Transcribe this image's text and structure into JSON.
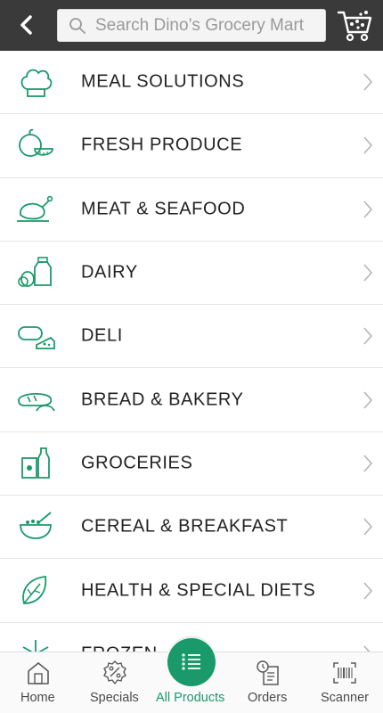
{
  "header": {
    "search_placeholder": "Search Dino’s Grocery Mart",
    "back_icon": "back-arrow-icon",
    "cart_icon": "cart-icon"
  },
  "categories": [
    {
      "label": "MEAL SOLUTIONS",
      "icon": "chef-hat-icon"
    },
    {
      "label": "FRESH PRODUCE",
      "icon": "produce-icon"
    },
    {
      "label": "MEAT & SEAFOOD",
      "icon": "chicken-icon"
    },
    {
      "label": "DAIRY",
      "icon": "milk-icon"
    },
    {
      "label": "DELI",
      "icon": "deli-icon"
    },
    {
      "label": "BREAD & BAKERY",
      "icon": "bread-icon"
    },
    {
      "label": "GROCERIES",
      "icon": "groceries-icon"
    },
    {
      "label": "CEREAL & BREAKFAST",
      "icon": "cereal-bowl-icon"
    },
    {
      "label": "HEALTH & SPECIAL DIETS",
      "icon": "leaf-icon"
    },
    {
      "label": "FROZEN",
      "icon": "snowflake-icon"
    }
  ],
  "nav": {
    "home": "Home",
    "specials": "Specials",
    "all_products": "All Products",
    "orders": "Orders",
    "scanner": "Scanner"
  },
  "colors": {
    "accent": "#1a9a6a",
    "header_bg": "#3a3a3a"
  }
}
